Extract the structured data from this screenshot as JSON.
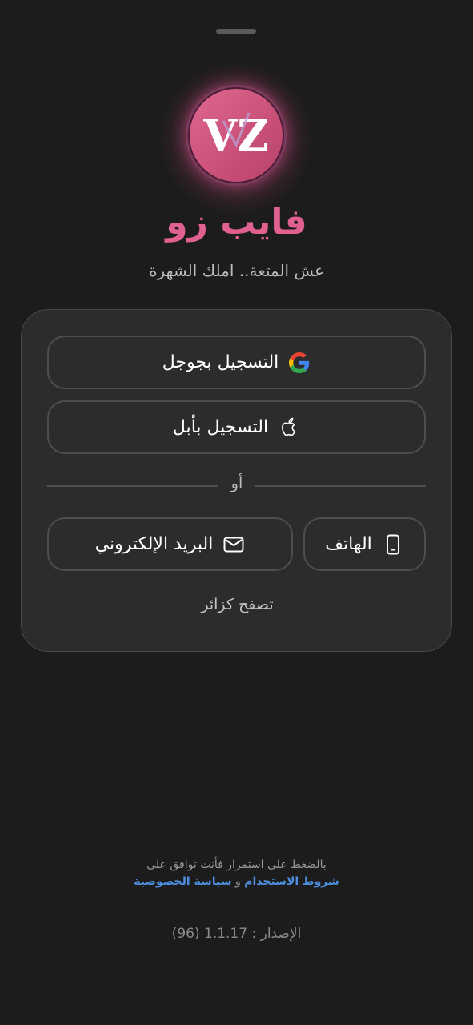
{
  "brand": {
    "name": "فايب زو",
    "tagline": "عش المتعة.. املك الشهرة",
    "logo_letters": "VZ",
    "accent_color": "#e0608f"
  },
  "auth": {
    "google_label": "التسجيل بجوجل",
    "apple_label": "التسجيل بأبل",
    "divider_label": "أو",
    "phone_label": "الهاتف",
    "email_label": "البريد الإلكتروني",
    "guest_label": "تصفح كزائر"
  },
  "icons": {
    "google": "google-icon",
    "apple": "apple-icon",
    "phone": "phone-icon",
    "email": "email-icon"
  },
  "footer": {
    "consent_text": "بالضغط على استمرار فأنت توافق على",
    "terms_link": "شروط الاستخدام",
    "conjunction": "و",
    "privacy_link": "سياسة الخصوصية",
    "link_color": "#4d8fe0",
    "version": "الإصدار : 1.1.17 (96)"
  }
}
